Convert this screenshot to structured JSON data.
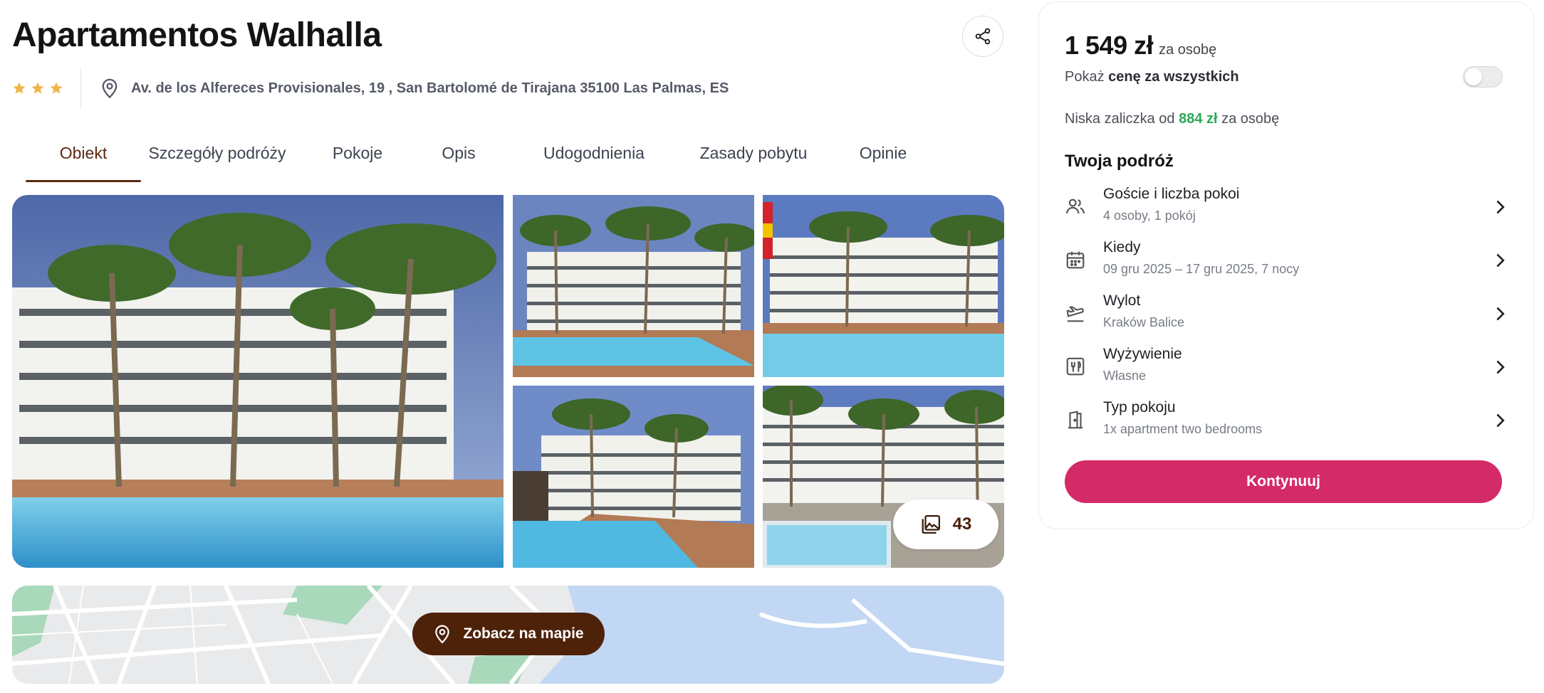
{
  "hotel": {
    "name": "Apartamentos Walhalla",
    "stars": 3,
    "address": "Av. de los Alfereces Provisionales, 19 , San Bartolomé de Tirajana 35100 Las Palmas, ES"
  },
  "tabs": [
    {
      "label": "Obiekt",
      "active": true
    },
    {
      "label": "Szczegóły podróży",
      "active": false
    },
    {
      "label": "Pokoje",
      "active": false
    },
    {
      "label": "Opis",
      "active": false
    },
    {
      "label": "Udogodnienia",
      "active": false
    },
    {
      "label": "Zasady pobytu",
      "active": false
    },
    {
      "label": "Opinie",
      "active": false
    }
  ],
  "gallery": {
    "photo_count": "43"
  },
  "map": {
    "button_label": "Zobacz na mapie"
  },
  "booking": {
    "price": "1 549 zł",
    "price_unit": "za osobę",
    "toggle_prefix": "Pokaż",
    "toggle_bold": "cenę za wszystkich",
    "toggle_on": false,
    "deposit_prefix": "Niska zaliczka od",
    "deposit_amount": "884 zł",
    "deposit_suffix": "za osobę",
    "trip_heading": "Twoja podróż",
    "trip_items": [
      {
        "icon": "users-icon",
        "label": "Goście i liczba pokoi",
        "value": "4 osoby, 1 pokój"
      },
      {
        "icon": "calendar-icon",
        "label": "Kiedy",
        "value": "09 gru 2025 – 17 gru 2025, 7 nocy"
      },
      {
        "icon": "plane-departure-icon",
        "label": "Wylot",
        "value": "Kraków Balice"
      },
      {
        "icon": "meal-icon",
        "label": "Wyżywienie",
        "value": "Własne"
      },
      {
        "icon": "door-icon",
        "label": "Typ pokoju",
        "value": "1x apartment two bedrooms"
      }
    ],
    "continue_label": "Kontynuuj"
  },
  "colors": {
    "accent_brown": "#5a2a10",
    "button_pink": "#d42a67",
    "deposit_green": "#2ea85b",
    "star_gold": "#f0b54a"
  }
}
